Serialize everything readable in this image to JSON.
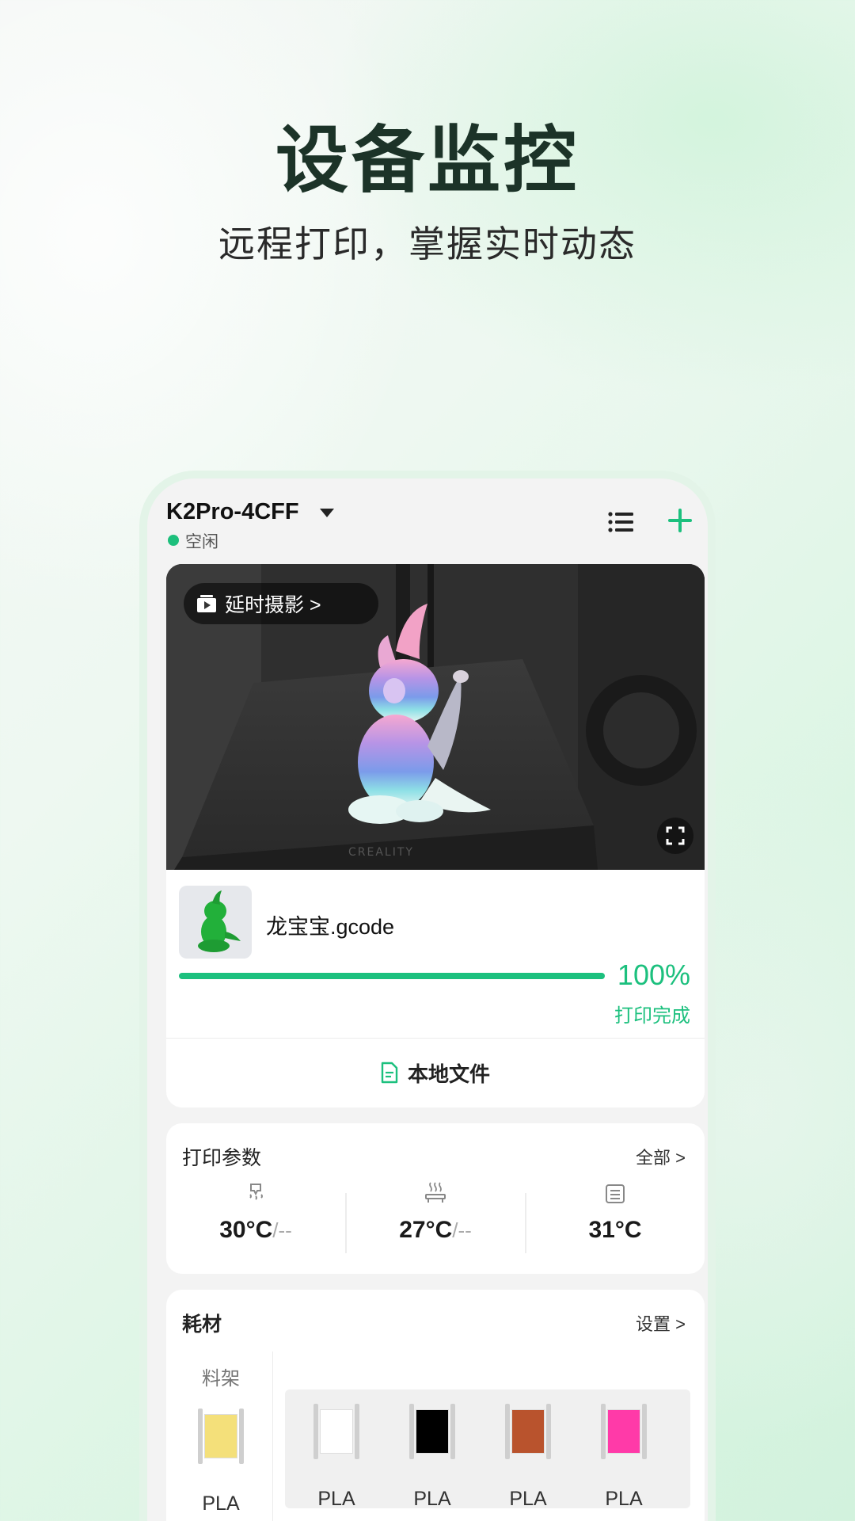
{
  "hero": {
    "title": "设备监控",
    "subtitle": "远程打印，掌握实时动态"
  },
  "device": {
    "name": "K2Pro-4CFF",
    "status": "空闲",
    "status_color": "#1dbf7c"
  },
  "header_icons": [
    "list-icon",
    "plus-icon"
  ],
  "camera": {
    "timelapse_label": "延时摄影 >",
    "bed_text": "CREALITY"
  },
  "job": {
    "file_name": "龙宝宝.gcode",
    "progress_percent": 100,
    "progress_text": "100%",
    "status_text": "打印完成",
    "local_file_label": "本地文件"
  },
  "params": {
    "title": "打印参数",
    "all_link": "全部 >",
    "items": [
      {
        "icon": "nozzle-temp-icon",
        "value": "30°C",
        "target": "/--"
      },
      {
        "icon": "bed-temp-icon",
        "value": "27°C",
        "target": "/--"
      },
      {
        "icon": "chamber-temp-icon",
        "value": "31°C",
        "target": ""
      }
    ]
  },
  "materials": {
    "title": "耗材",
    "settings_link": "设置 >",
    "rack": {
      "label": "料架",
      "type": "PLA",
      "color": "#f4e07a"
    },
    "slots": [
      {
        "type": "PLA",
        "color": "#ffffff"
      },
      {
        "type": "PLA",
        "color": "#000000"
      },
      {
        "type": "PLA",
        "color": "#b9532d"
      },
      {
        "type": "PLA",
        "color": "#ff3aa8"
      }
    ]
  },
  "accent_color": "#1cc07e"
}
